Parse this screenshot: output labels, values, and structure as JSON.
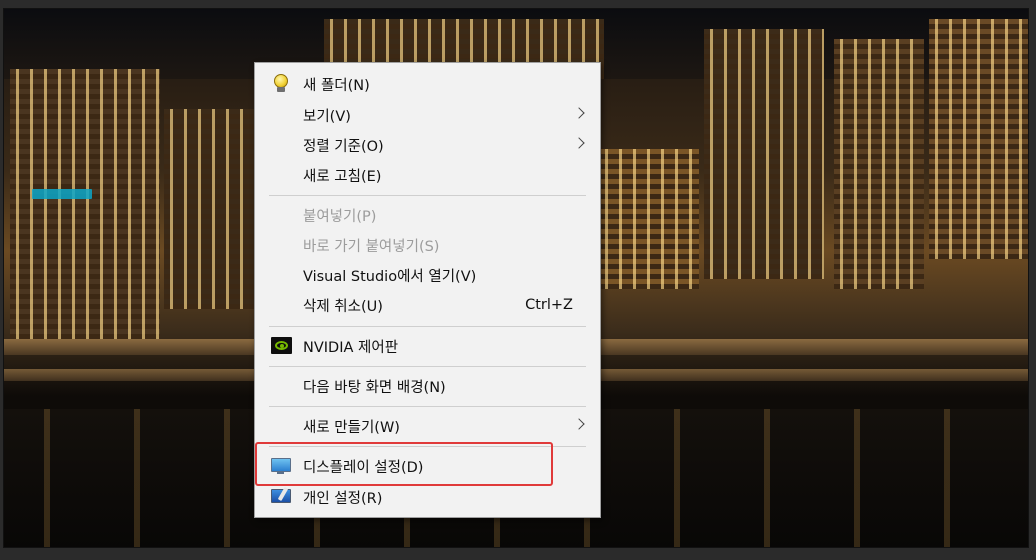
{
  "context_menu": {
    "items": [
      {
        "label": "새 폴더(N)",
        "icon": "bulb-icon",
        "disabled": false
      },
      {
        "label": "보기(V)",
        "submenu": true,
        "disabled": false
      },
      {
        "label": "정렬 기준(O)",
        "submenu": true,
        "disabled": false
      },
      {
        "label": "새로 고침(E)",
        "disabled": false
      },
      {
        "label": "붙여넣기(P)",
        "disabled": true
      },
      {
        "label": "바로 가기 붙여넣기(S)",
        "disabled": true
      },
      {
        "label": "Visual Studio에서 열기(V)",
        "disabled": false
      },
      {
        "label": "삭제 취소(U)",
        "shortcut": "Ctrl+Z",
        "disabled": false
      },
      {
        "label": "NVIDIA 제어판",
        "icon": "nvidia-icon",
        "disabled": false
      },
      {
        "label": "다음 바탕 화면 배경(N)",
        "disabled": false
      },
      {
        "label": "새로 만들기(W)",
        "submenu": true,
        "disabled": false
      },
      {
        "label": "디스플레이 설정(D)",
        "icon": "display-settings-icon",
        "disabled": false,
        "highlighted": true
      },
      {
        "label": "개인 설정(R)",
        "icon": "personalize-icon",
        "disabled": false
      }
    ]
  },
  "colors": {
    "menu_background": "#f2f2f2",
    "highlight_border": "#e03a3a",
    "disabled_text": "#9c9c9c"
  }
}
